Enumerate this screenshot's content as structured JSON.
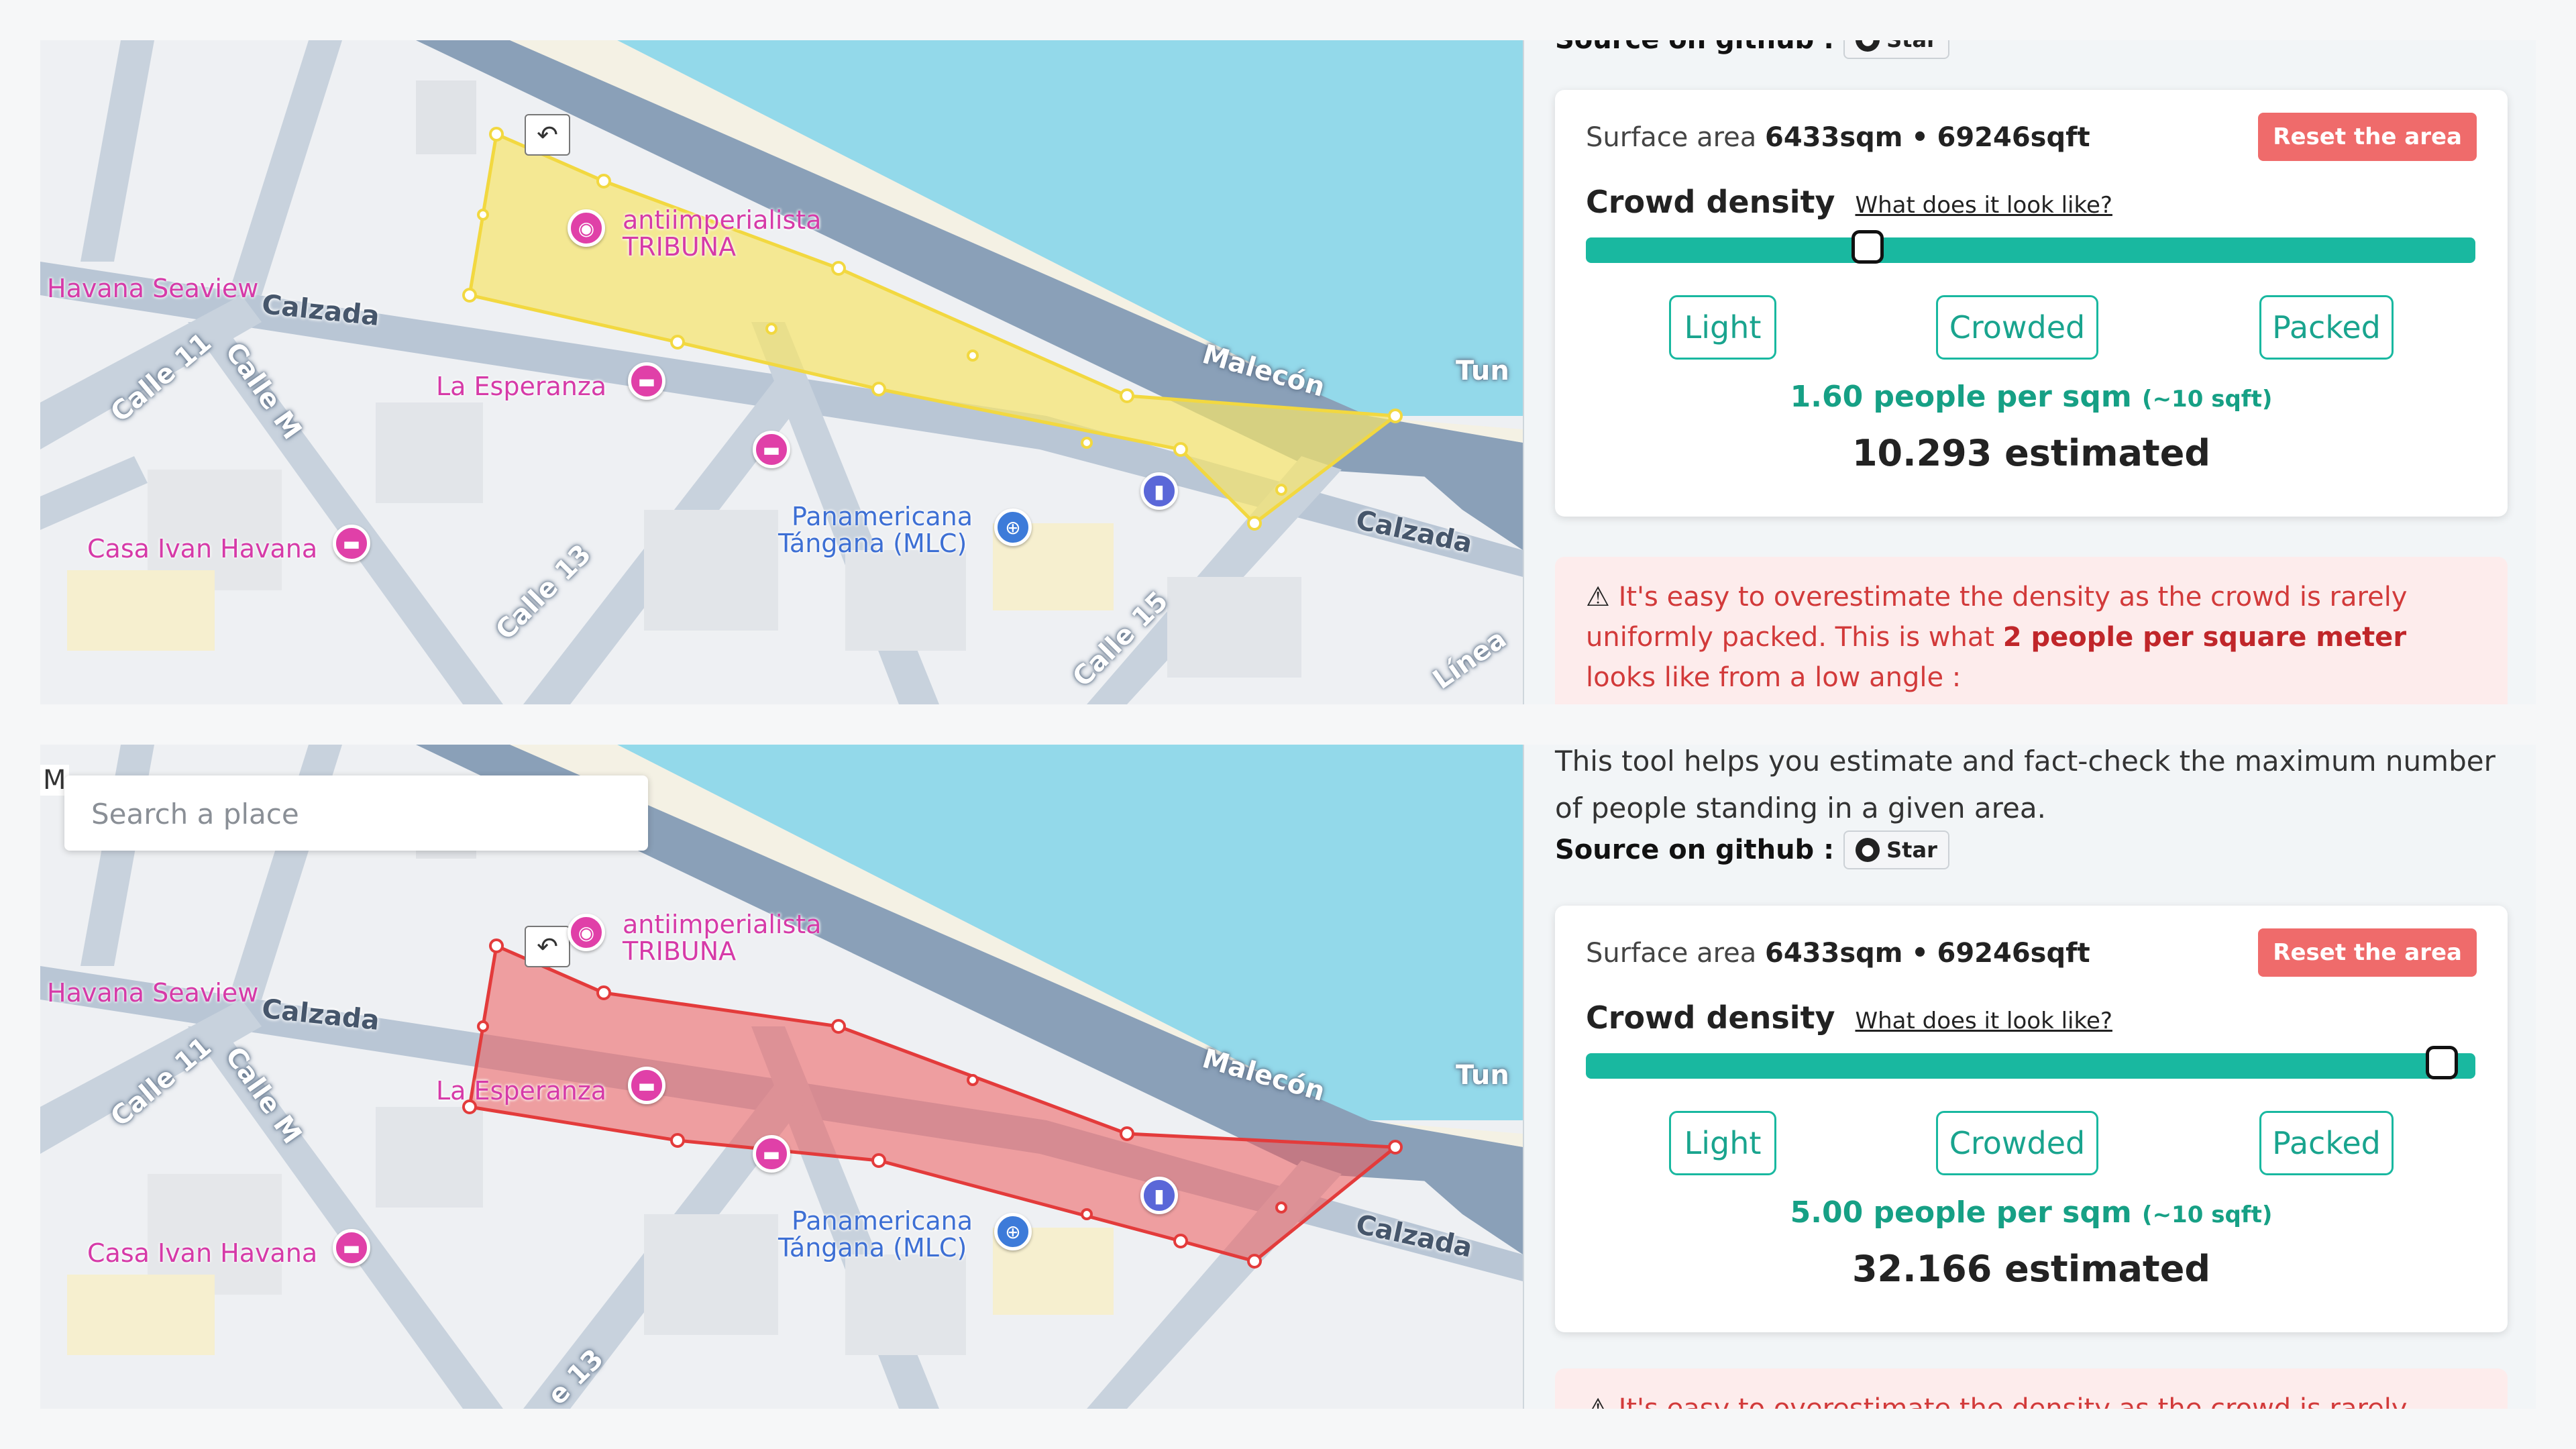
{
  "map": {
    "labels": {
      "calzada_top": "Calzada",
      "calzada_right": "Calzada",
      "malecon": "Malecón",
      "tun": "Tun",
      "linea": "Línea",
      "calle11": "Calle 11",
      "calleM": "Calle M",
      "calle13": "Calle 13",
      "calle15": "Calle 15",
      "calle13_bottom": "e 13",
      "m_cut": "M"
    },
    "pois": {
      "havana_seaview": "Havana Seaview",
      "la_esperanza": "La Esperanza",
      "casa_ivan": "Casa Ivan Havana",
      "antiimperialista_1": "antiimperialista",
      "antiimperialista_2": "TRIBUNA",
      "panamericana_1": "Panamericana",
      "panamericana_2": "Tángana (MLC)"
    },
    "search_placeholder": "Search a place",
    "polygon_colors": {
      "top": "#f7e46a",
      "bottom": "#ef5b5b"
    }
  },
  "panel": {
    "intro": "This tool helps you estimate and fact-check the maximum number of people standing in a given area.",
    "source_label": "Source on github :",
    "star_label": "Star",
    "surface_label": "Surface area",
    "surface_sqm": "6433sqm",
    "separator": "•",
    "surface_sqft": "69246sqft",
    "reset_label": "Reset the area",
    "crowd_density_label": "Crowd density",
    "what_link": "What does it look like?",
    "light": "Light",
    "crowded": "Crowded",
    "packed": "Packed",
    "sqft_note": "(~10 sqft)",
    "warning_icon": "⚠",
    "warning_text_1": "It's easy to overestimate the density as the crowd is rarely uniformly packed. This is what",
    "warning_bold": "2 people per square meter",
    "warning_text_2": "looks like from a low angle :",
    "warning_cut": "It's easy to overestimate the density as the crowd is rarely uniformly",
    "top": {
      "people_per_sqm": "1.60 people per sqm",
      "estimated": "10.293 estimated",
      "slider_fraction": 0.31
    },
    "bottom": {
      "people_per_sqm": "5.00 people per sqm",
      "estimated": "32.166 estimated",
      "slider_fraction": 0.98
    }
  }
}
